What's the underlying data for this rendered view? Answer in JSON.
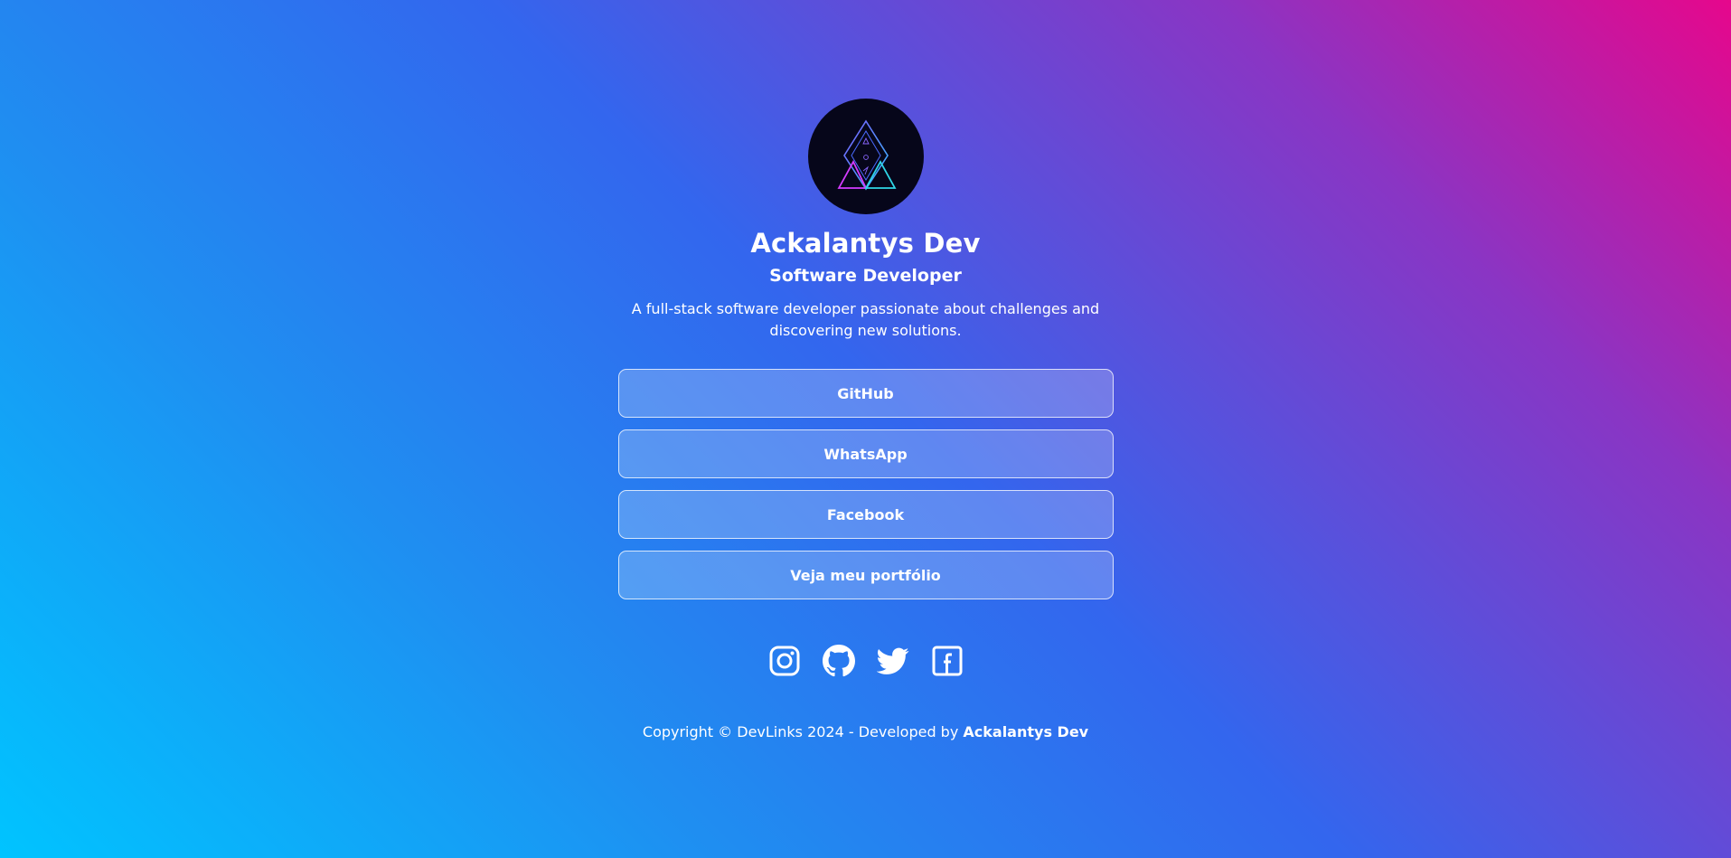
{
  "profile": {
    "name": "Ackalantys Dev",
    "role": "Software Developer",
    "bio": "A full-stack software developer passionate about challenges and discovering new solutions.",
    "avatar_icon": "triangle-crest-logo"
  },
  "links": [
    {
      "label": "GitHub"
    },
    {
      "label": "WhatsApp"
    },
    {
      "label": "Facebook"
    },
    {
      "label": "Veja meu portfólio"
    }
  ],
  "socials": [
    {
      "icon": "instagram-icon"
    },
    {
      "icon": "github-icon"
    },
    {
      "icon": "twitter-icon"
    },
    {
      "icon": "facebook-icon"
    }
  ],
  "footer": {
    "prefix": "Copyright © DevLinks 2024 - Developed by ",
    "author": "Ackalantys Dev"
  },
  "colors": {
    "gradient_top_right": "#e6078c",
    "gradient_mid": "#3366ee",
    "gradient_bottom_left": "#00c4ff",
    "avatar_bg": "#06061a"
  }
}
